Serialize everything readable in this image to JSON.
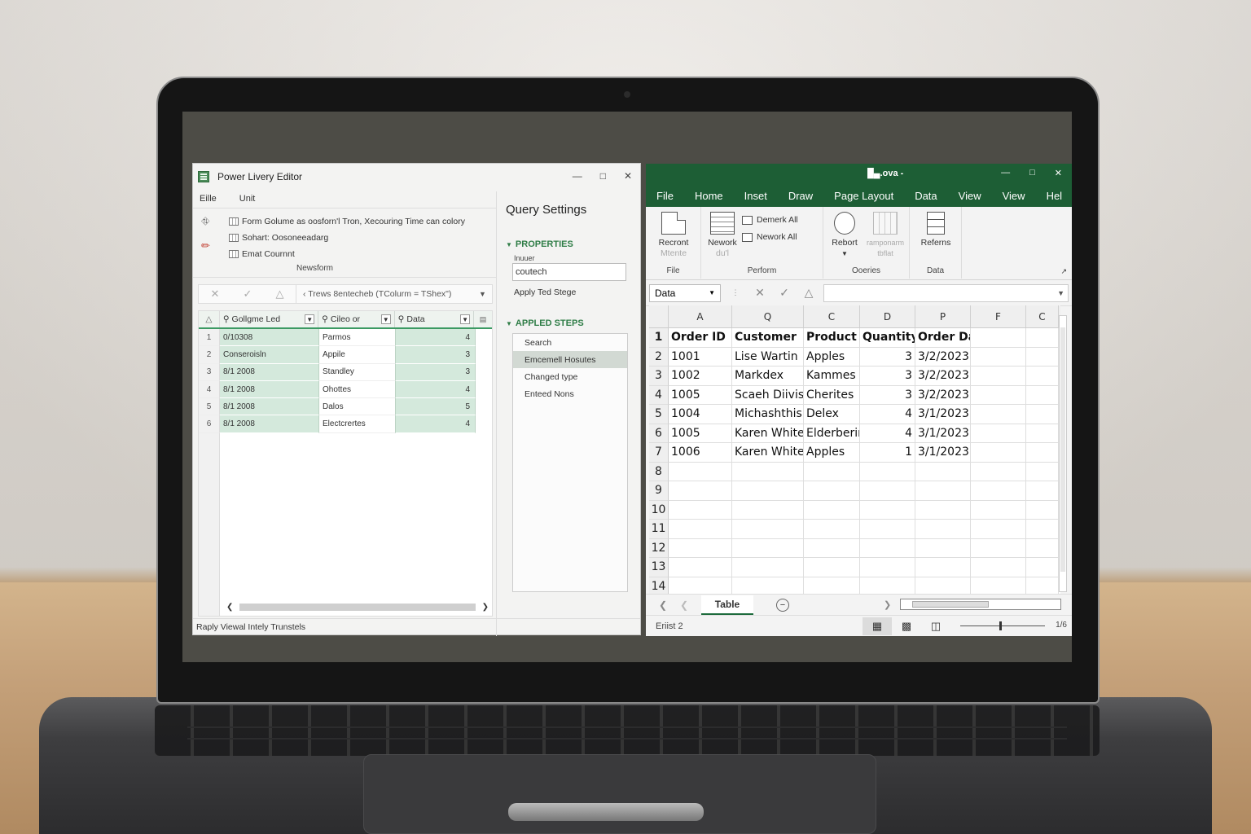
{
  "power_query": {
    "title": "Power Livery Editor",
    "menu": [
      "Eille",
      "Unit"
    ],
    "ribbon": {
      "items": [
        "Form Golume as oosforn'l Tron, Xecouring Time can colory",
        "Sohart: Oosoneeadarg",
        "Emat Cournnt"
      ],
      "group_label": "Newsform"
    },
    "formula_text": "‹ Trews 8entecheb (TColurm = TShex\")",
    "columns": [
      "Gollgme Led",
      "Cileo or",
      "Data"
    ],
    "rows": [
      {
        "n": "1",
        "c1": "0/10308",
        "c2": "Parmos",
        "c3": "4"
      },
      {
        "n": "2",
        "c1": "Conseroisln",
        "c2": "Appile",
        "c3": "3"
      },
      {
        "n": "3",
        "c1": "8/1 2008",
        "c2": "Standley",
        "c3": "3"
      },
      {
        "n": "4",
        "c1": "8/1 2008",
        "c2": "Ohottes",
        "c3": "4"
      },
      {
        "n": "5",
        "c1": "8/1 2008",
        "c2": "Dalos",
        "c3": "5"
      },
      {
        "n": "6",
        "c1": "8/1 2008",
        "c2": "Electcrertes",
        "c3": "4"
      }
    ],
    "status": "Raply Viewal Intely Trunstels"
  },
  "query_settings": {
    "title": "Query Settings",
    "properties_label": "PROPERTIES",
    "name_label": "Inuuer",
    "name_value": "coutech",
    "apply_link": "Apply Ted Stege",
    "steps_label": "APPLED STEPS",
    "steps": [
      "Search",
      "Emcemell Hosutes",
      "Changed type",
      "Enteed Nons"
    ]
  },
  "excel": {
    "title": "█▄.ova  -",
    "tabs": [
      "File",
      "Home",
      "Inset",
      "Draw",
      "Page Layout",
      "Data",
      "View",
      "View",
      "Hel"
    ],
    "ribbon": {
      "file_btn": [
        "Recront",
        "Mtente"
      ],
      "file_group": "File",
      "nework_btn": [
        "Nework",
        "du'l"
      ],
      "demerk": "Demerk All",
      "nework_all": "Nework All",
      "perform_group": "Perform",
      "rebort": "Rebort",
      "grey_btn": [
        "ramponarm",
        "tbflat"
      ],
      "queries_group": "Ooeries",
      "referns": "Referns",
      "data_group": "Data"
    },
    "name_box": "Data",
    "col_headers": [
      "A",
      "Q",
      "C",
      "D",
      "P",
      "F",
      "C"
    ],
    "header_row": {
      "n": "1",
      "a": "Order ID",
      "b": "Customer",
      "c": "Product",
      "d": "Quantity",
      "e": "Order Date"
    },
    "rows": [
      {
        "n": "2",
        "a": "1001",
        "b": "Lise Wartin",
        "c": "Apples",
        "d": "3",
        "e": "3/2/2023"
      },
      {
        "n": "3",
        "a": "1002",
        "b": "Markdex",
        "c": "Kammes",
        "d": "3",
        "e": "3/2/2023"
      },
      {
        "n": "4",
        "a": "1005",
        "b": "Scaeh Diivis",
        "c": "Cherites",
        "d": "3",
        "e": "3/2/2023"
      },
      {
        "n": "5",
        "a": "1004",
        "b": "Michashthis",
        "c": "Delex",
        "d": "4",
        "e": "3/1/2023"
      },
      {
        "n": "6",
        "a": "1005",
        "b": "Karen White",
        "c": "Elderberin",
        "d": "4",
        "e": "3/1/2023"
      },
      {
        "n": "7",
        "a": "1006",
        "b": "Karen White",
        "c": "Apples",
        "d": "1",
        "e": "3/1/2023"
      }
    ],
    "empty_rows": [
      "8",
      "9",
      "10",
      "11",
      "12",
      "13",
      "14"
    ],
    "sheet_tab": "Table",
    "status_left": "Eriist 2",
    "zoom_text": "1/6"
  }
}
